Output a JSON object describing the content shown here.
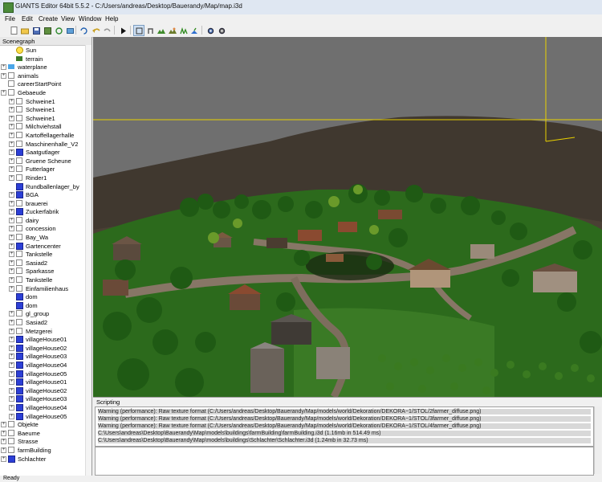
{
  "window": {
    "title": "GIANTS Editor 64bit 5.5.2 - C:/Users/andreas/Desktop/Bauerandy/Map/map.i3d"
  },
  "menu": [
    "File",
    "Edit",
    "Create",
    "View",
    "Window",
    "Help"
  ],
  "toolbar": {
    "buttons": [
      {
        "name": "new-file-icon"
      },
      {
        "name": "open-folder-icon"
      },
      {
        "name": "save-icon"
      },
      {
        "name": "save-as-icon"
      },
      {
        "name": "refresh-icon"
      },
      {
        "name": "import-icon"
      },
      {
        "name": "export-icon"
      },
      {
        "name": "reload-icon"
      },
      {
        "name": "undo-icon"
      },
      {
        "name": "redo-icon"
      },
      {
        "name": "play-icon"
      },
      {
        "name": "select-mode-icon"
      },
      {
        "name": "move-mode-icon"
      },
      {
        "name": "terrain-sculpt-icon"
      },
      {
        "name": "terrain-paint-icon"
      },
      {
        "name": "foliage-paint-icon"
      },
      {
        "name": "grass-paint-icon"
      },
      {
        "name": "settings-gear-icon"
      },
      {
        "name": "snap-settings-icon"
      }
    ]
  },
  "scenegraph": {
    "title": "Scenegraph",
    "nodes": [
      {
        "label": "Sun",
        "icon": "light",
        "level": 1,
        "expander": false
      },
      {
        "label": "terrain",
        "icon": "terrain",
        "level": 1,
        "expander": false
      },
      {
        "label": "waterplane",
        "icon": "water",
        "level": 0,
        "expander": true
      },
      {
        "label": "animals",
        "icon": "tg",
        "level": 0,
        "expander": true
      },
      {
        "label": "careerStartPoint",
        "icon": "tg",
        "level": 0,
        "expander": false
      },
      {
        "label": "Gebaeude",
        "icon": "tg",
        "level": 0,
        "expander": true
      },
      {
        "label": "Schweine1",
        "icon": "tg",
        "level": 1,
        "expander": true
      },
      {
        "label": "Schweine1",
        "icon": "tg",
        "level": 1,
        "expander": true
      },
      {
        "label": "Schweine1",
        "icon": "tg",
        "level": 1,
        "expander": true
      },
      {
        "label": "Milchviehstall",
        "icon": "tg",
        "level": 1,
        "expander": true
      },
      {
        "label": "Kartoffellagerhalle",
        "icon": "tg",
        "level": 1,
        "expander": true
      },
      {
        "label": "Maschinenhalle_V2",
        "icon": "tg",
        "level": 1,
        "expander": true
      },
      {
        "label": "Saatgutlager",
        "icon": "shape",
        "level": 1,
        "expander": true
      },
      {
        "label": "Gruene Scheune",
        "icon": "tg",
        "level": 1,
        "expander": true
      },
      {
        "label": "Futterlager",
        "icon": "tg",
        "level": 1,
        "expander": true
      },
      {
        "label": "Rinder1",
        "icon": "tg",
        "level": 1,
        "expander": true
      },
      {
        "label": "Rundballenlager_by",
        "icon": "shape",
        "level": 1,
        "expander": false
      },
      {
        "label": "BGA",
        "icon": "shape",
        "level": 1,
        "expander": true
      },
      {
        "label": "brauerei",
        "icon": "tg",
        "level": 1,
        "expander": true
      },
      {
        "label": "Zuckerfabrik",
        "icon": "shape",
        "level": 1,
        "expander": true
      },
      {
        "label": "dairy",
        "icon": "tg",
        "level": 1,
        "expander": true
      },
      {
        "label": "concession",
        "icon": "tg",
        "level": 1,
        "expander": true
      },
      {
        "label": "Bay_Wa",
        "icon": "tg",
        "level": 1,
        "expander": true
      },
      {
        "label": "Gartencenter",
        "icon": "shape",
        "level": 1,
        "expander": true
      },
      {
        "label": "Tankstelle",
        "icon": "tg",
        "level": 1,
        "expander": true
      },
      {
        "label": "Sasiad2",
        "icon": "tg",
        "level": 1,
        "expander": true
      },
      {
        "label": "Sparkasse",
        "icon": "tg",
        "level": 1,
        "expander": true
      },
      {
        "label": "Tankstelle",
        "icon": "tg",
        "level": 1,
        "expander": true
      },
      {
        "label": "Einfamilienhaus",
        "icon": "tg",
        "level": 1,
        "expander": true
      },
      {
        "label": "dom",
        "icon": "shape",
        "level": 1,
        "expander": false
      },
      {
        "label": "dom",
        "icon": "shape",
        "level": 1,
        "expander": false
      },
      {
        "label": "gl_group",
        "icon": "tg",
        "level": 1,
        "expander": true
      },
      {
        "label": "Sasiad2",
        "icon": "tg",
        "level": 1,
        "expander": true
      },
      {
        "label": "Metzgerei",
        "icon": "tg",
        "level": 1,
        "expander": true
      },
      {
        "label": "villageHouse01",
        "icon": "shape",
        "level": 1,
        "expander": true
      },
      {
        "label": "villageHouse02",
        "icon": "shape",
        "level": 1,
        "expander": true
      },
      {
        "label": "villageHouse03",
        "icon": "shape",
        "level": 1,
        "expander": true
      },
      {
        "label": "villageHouse04",
        "icon": "shape",
        "level": 1,
        "expander": true
      },
      {
        "label": "villageHouse05",
        "icon": "shape",
        "level": 1,
        "expander": true
      },
      {
        "label": "villageHouse01",
        "icon": "shape",
        "level": 1,
        "expander": true
      },
      {
        "label": "villageHouse02",
        "icon": "shape",
        "level": 1,
        "expander": true
      },
      {
        "label": "villageHouse03",
        "icon": "shape",
        "level": 1,
        "expander": true
      },
      {
        "label": "villageHouse04",
        "icon": "shape",
        "level": 1,
        "expander": true
      },
      {
        "label": "villageHouse05",
        "icon": "shape",
        "level": 1,
        "expander": true
      },
      {
        "label": "Objekte",
        "icon": "tg",
        "level": 0,
        "expander": true
      },
      {
        "label": "Baeume",
        "icon": "tg",
        "level": 0,
        "expander": true
      },
      {
        "label": "Strasse",
        "icon": "tg",
        "level": 0,
        "expander": true
      },
      {
        "label": "farmBuilding",
        "icon": "tg",
        "level": 0,
        "expander": true
      },
      {
        "label": "Schlachter",
        "icon": "shape",
        "level": 0,
        "expander": true
      }
    ]
  },
  "scripting": {
    "title": "Scripting",
    "log": [
      "Warning (performance): Raw texture format (C:/Users/andreas/Desktop/Bauerandy/Map/models/world/Dekoration/DEKORA~1/STOL/2farmer_diffuse.png)",
      "Warning (performance): Raw texture format (C:/Users/andreas/Desktop/Bauerandy/Map/models/world/Dekoration/DEKORA~1/STOL/3farmer_diffuse.png)",
      "Warning (performance): Raw texture format (C:/Users/andreas/Desktop/Bauerandy/Map/models/world/Dekoration/DEKORA~1/STOL/4farmer_diffuse.png)",
      "C:\\Users\\andreas\\Desktop\\Bauerandy\\Map\\models\\buildings\\farmBuilding\\farmBuilding.i3d (1.16mb in 514.49 ms)",
      "C:\\Users\\andreas\\Desktop\\Bauerandy\\Map\\models\\buildings\\Schlachter\\Schlachter.i3d (1.24mb in 32.73 ms)"
    ]
  },
  "status": {
    "text": "Ready"
  },
  "colors": {
    "sky": "#6e6e6e",
    "grass": "#2f6b1e",
    "field": "#4a4036",
    "road": "#807060",
    "selection_lines": "#e8d000"
  }
}
